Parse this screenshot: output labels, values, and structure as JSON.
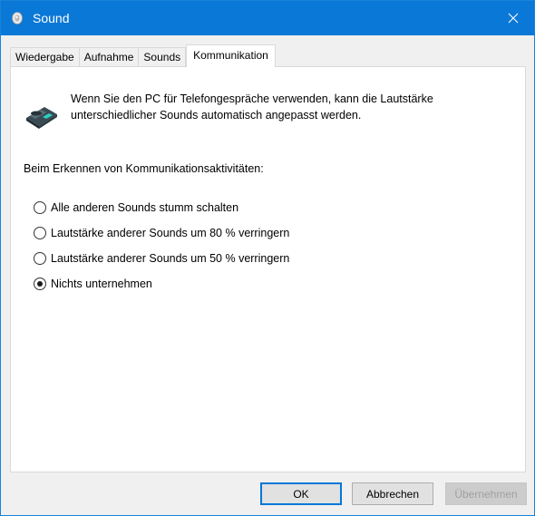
{
  "window": {
    "title": "Sound"
  },
  "tabs": [
    {
      "label": "Wiedergabe"
    },
    {
      "label": "Aufnahme"
    },
    {
      "label": "Sounds"
    },
    {
      "label": "Kommunikation"
    }
  ],
  "active_tab": "Kommunikation",
  "panel": {
    "description_line1": "Wenn Sie den PC für Telefongespräche verwenden, kann die Lautstärke",
    "description_line2": "unterschiedlicher Sounds automatisch angepasst werden.",
    "section_label": "Beim Erkennen von Kommunikationsaktivitäten:",
    "options": [
      {
        "label": "Alle anderen Sounds stumm schalten",
        "checked": false
      },
      {
        "label": "Lautstärke anderer Sounds um 80 % verringern",
        "checked": false
      },
      {
        "label": "Lautstärke anderer Sounds um 50 % verringern",
        "checked": false
      },
      {
        "label": "Nichts unternehmen",
        "checked": true
      }
    ]
  },
  "buttons": {
    "ok": "OK",
    "cancel": "Abbrechen",
    "apply": "Übernehmen"
  },
  "icons": {
    "title": "speaker-icon",
    "close": "close-icon",
    "panel": "telephone-icon"
  },
  "colors": {
    "titlebar": "#0a78d7",
    "accent": "#0078d7"
  }
}
